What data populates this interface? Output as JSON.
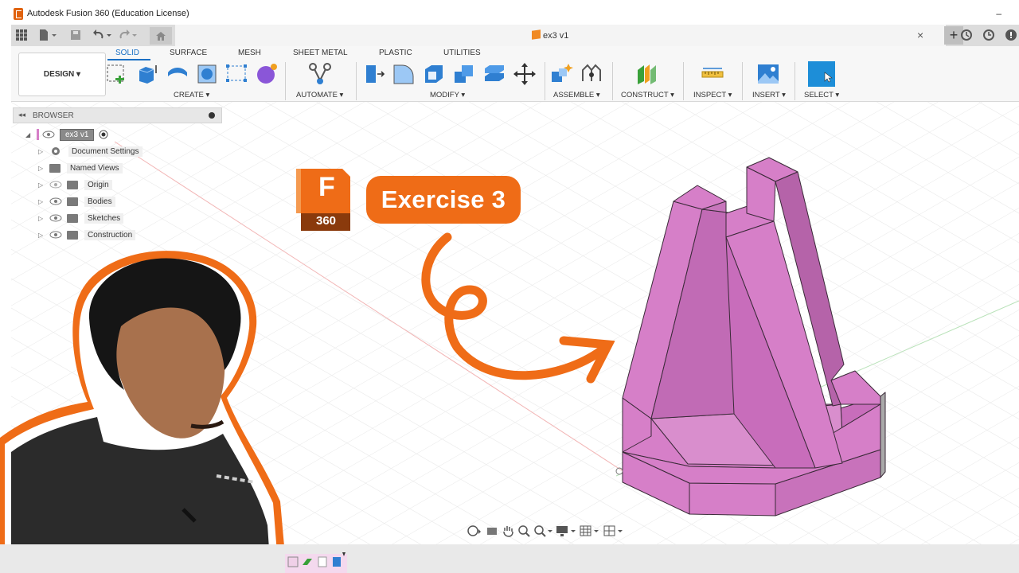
{
  "window": {
    "title": "Autodesk Fusion 360 (Education License)",
    "minimize": "–"
  },
  "document_tab": {
    "title": "ex3 v1",
    "close": "×",
    "new_tab": "+"
  },
  "workspace": {
    "selector": "DESIGN ▾"
  },
  "ribbon_tabs": [
    {
      "label": "SOLID",
      "active": true
    },
    {
      "label": "SURFACE",
      "active": false
    },
    {
      "label": "MESH",
      "active": false
    },
    {
      "label": "SHEET METAL",
      "active": false
    },
    {
      "label": "PLASTIC",
      "active": false
    },
    {
      "label": "UTILITIES",
      "active": false
    }
  ],
  "ribbon_groups": [
    {
      "label": "CREATE ▾"
    },
    {
      "label": "AUTOMATE ▾"
    },
    {
      "label": "MODIFY ▾"
    },
    {
      "label": "ASSEMBLE ▾"
    },
    {
      "label": "CONSTRUCT ▾"
    },
    {
      "label": "INSPECT ▾"
    },
    {
      "label": "INSERT ▾"
    },
    {
      "label": "SELECT ▾"
    }
  ],
  "browser": {
    "title": "BROWSER",
    "collapse": "◂◂",
    "root": "ex3 v1",
    "items": [
      {
        "label": "Document Settings",
        "icon": "gear-icon"
      },
      {
        "label": "Named Views",
        "icon": "folder-icon"
      },
      {
        "label": "Origin",
        "icon": "folder-icon"
      },
      {
        "label": "Bodies",
        "icon": "folder-icon"
      },
      {
        "label": "Sketches",
        "icon": "folder-icon"
      },
      {
        "label": "Construction",
        "icon": "folder-icon"
      }
    ]
  },
  "overlay": {
    "logo_letter": "F",
    "logo_number": "360",
    "title": "Exercise 3"
  },
  "colors": {
    "accent": "#ef6c17",
    "model_fill": "#d67fc8",
    "model_shade": "#b85fab",
    "ribbon_active": "#1a6fc4"
  }
}
